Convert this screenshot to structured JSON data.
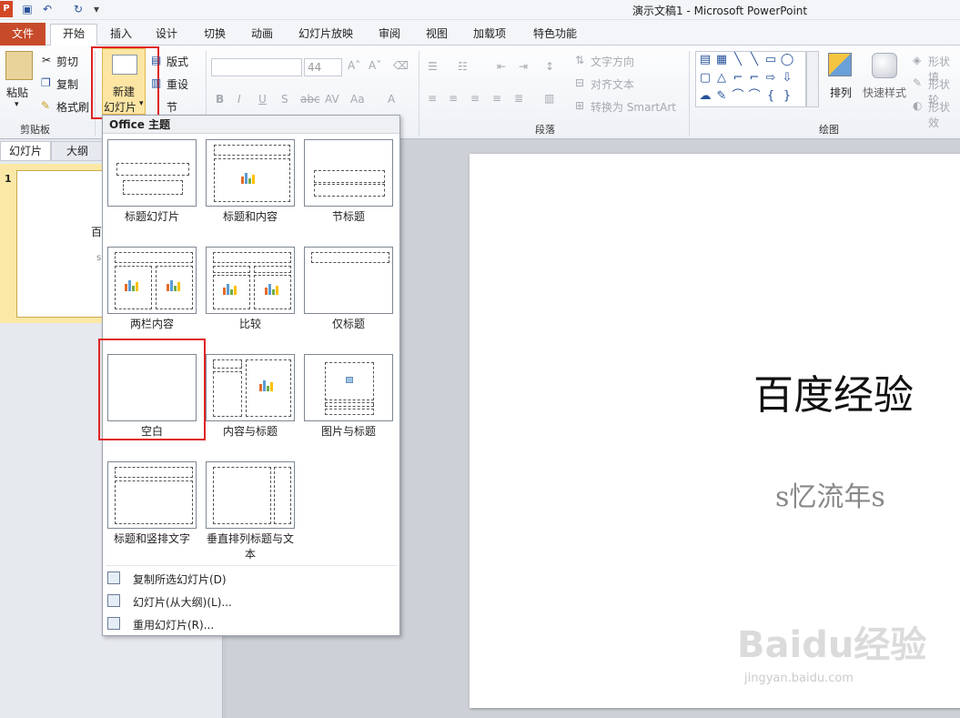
{
  "window": {
    "title": "演示文稿1 - Microsoft PowerPoint",
    "app_icon": "P"
  },
  "tabs": [
    "文件",
    "开始",
    "插入",
    "设计",
    "切换",
    "动画",
    "幻灯片放映",
    "审阅",
    "视图",
    "加载项",
    "特色功能"
  ],
  "ribbon": {
    "clipboard": {
      "paste": "粘贴",
      "cut": "剪切",
      "copy": "复制",
      "format_painter": "格式刷",
      "group": "剪贴板"
    },
    "slides": {
      "new_slide_line1": "新建",
      "new_slide_line2": "幻灯片",
      "layout": "版式",
      "reset": "重设",
      "section": "节"
    },
    "font": {
      "size": "44"
    },
    "paragraph": {
      "text_direction": "文字方向",
      "align_text": "对齐文本",
      "convert_smartart": "转换为 SmartArt",
      "group": "段落"
    },
    "drawing": {
      "arrange": "排列",
      "quick_styles": "快速样式",
      "shape_fill": "形状填",
      "shape_outline": "形状轮",
      "shape_effects": "形状效",
      "group": "绘图"
    }
  },
  "left_pane": {
    "tab_slides": "幻灯片",
    "tab_outline": "大纲",
    "slide_number": "1",
    "thumb_title": "百",
    "thumb_sub": "s"
  },
  "dropdown": {
    "header": "Office 主题",
    "layouts": [
      "标题幻灯片",
      "标题和内容",
      "节标题",
      "两栏内容",
      "比较",
      "仅标题",
      "空白",
      "内容与标题",
      "图片与标题",
      "标题和竖排文字",
      "垂直排列标题与文",
      "本"
    ],
    "menu": [
      "复制所选幻灯片(D)",
      "幻灯片(从大纲)(L)...",
      "重用幻灯片(R)..."
    ]
  },
  "slide": {
    "title": "百度经验",
    "subtitle": "s忆流年s"
  },
  "watermark": {
    "text": "Baidu经验",
    "sub": "jingyan.baidu.com"
  },
  "colors": {
    "file_tab": "#c74b2a",
    "highlight": "#e02424",
    "selected_thumb": "#fbe8a6"
  }
}
